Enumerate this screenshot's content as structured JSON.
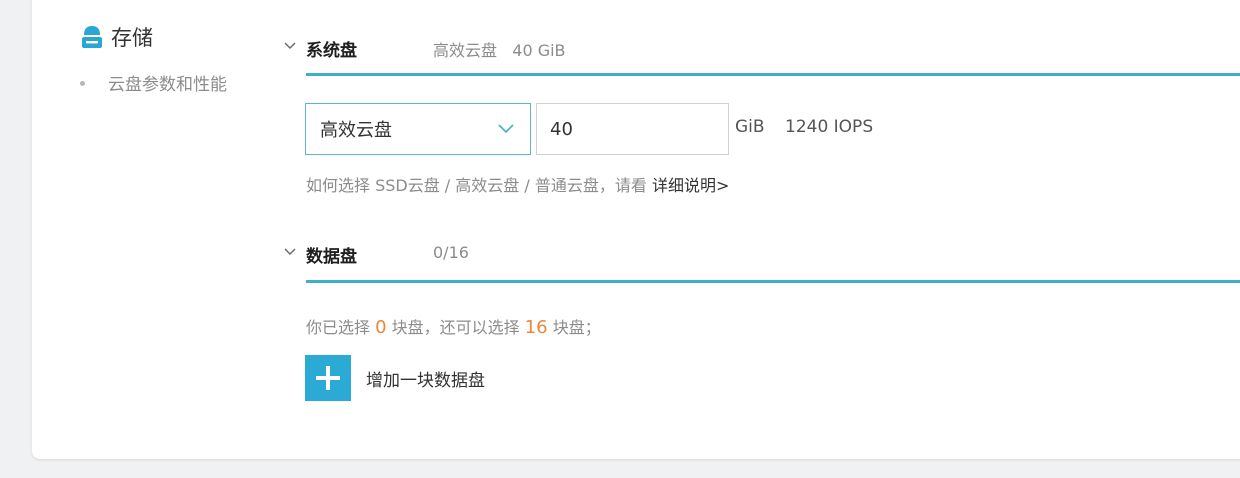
{
  "section": {
    "title": "存储",
    "icon": "database-icon",
    "nav_item": "云盘参数和性能"
  },
  "system_disk": {
    "label": "系统盘",
    "summary": "高效云盘   40 GiB",
    "type_selected": "高效云盘",
    "size_value": "40",
    "unit": "GiB",
    "iops": "1240 IOPS",
    "hint_prefix": "如何选择 SSD云盘 / 高效云盘 / 普通云盘，请看 ",
    "hint_link": "详细说明>"
  },
  "data_disk": {
    "label": "数据盘",
    "summary": "0/16",
    "status_prefix": "你已选择 ",
    "selected_count": "0",
    "status_middle": " 块盘，还可以选择 ",
    "remaining_count": "16",
    "status_suffix": " 块盘；",
    "add_label": "增加一块数据盘"
  },
  "colors": {
    "accent_line": "#3fb0c8",
    "add_button": "#2aaad4",
    "count_highlight": "#e8873b",
    "icon": "#2aa6d6"
  }
}
